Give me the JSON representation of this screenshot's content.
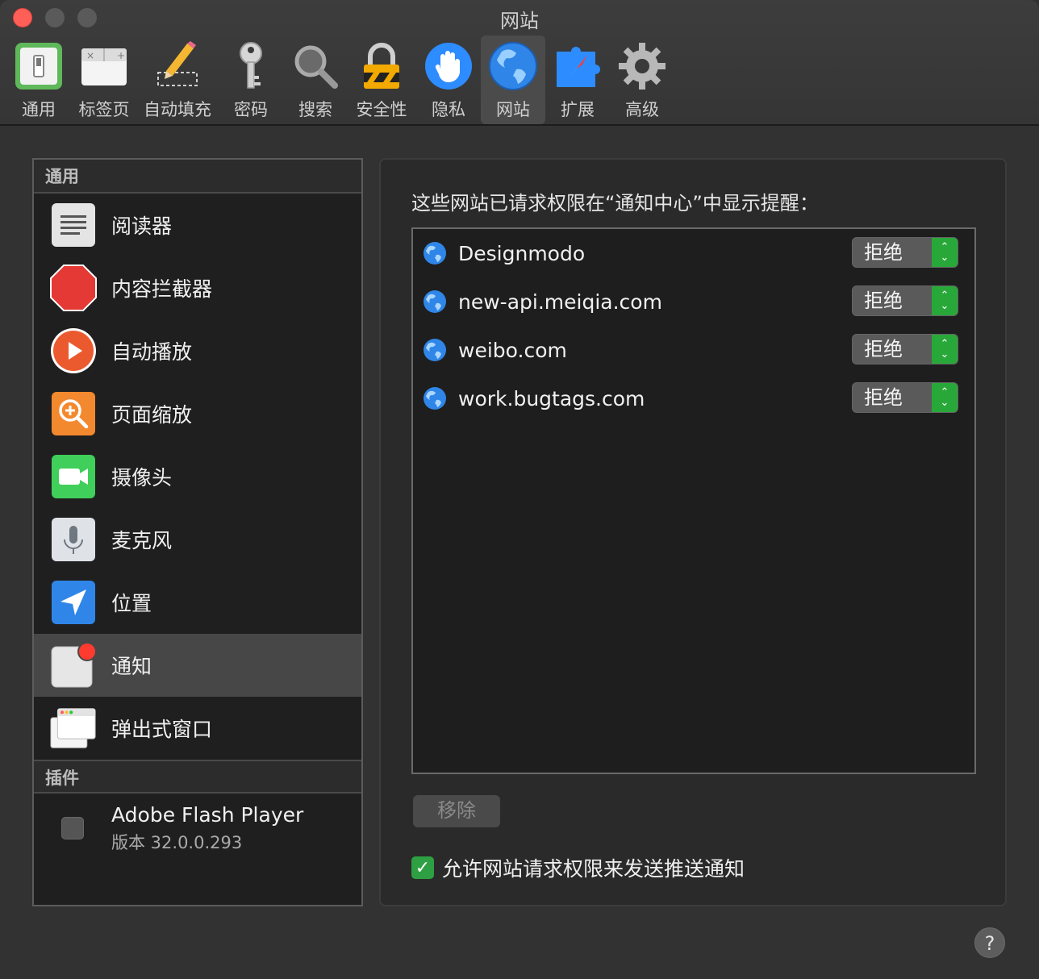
{
  "window": {
    "title": "网站"
  },
  "toolbar": {
    "items": [
      {
        "label": "通用",
        "icon": "general-switch-icon"
      },
      {
        "label": "标签页",
        "icon": "tabs-icon"
      },
      {
        "label": "自动填充",
        "icon": "pencil-icon"
      },
      {
        "label": "密码",
        "icon": "key-icon"
      },
      {
        "label": "搜索",
        "icon": "magnifier-icon"
      },
      {
        "label": "安全性",
        "icon": "lock-icon"
      },
      {
        "label": "隐私",
        "icon": "hand-icon"
      },
      {
        "label": "网站",
        "icon": "globe-icon",
        "selected": true
      },
      {
        "label": "扩展",
        "icon": "puzzle-icon"
      },
      {
        "label": "高级",
        "icon": "gear-icon"
      }
    ]
  },
  "sidebar": {
    "general_header": "通用",
    "items": [
      {
        "label": "阅读器",
        "icon": "reader-icon"
      },
      {
        "label": "内容拦截器",
        "icon": "stop-sign-icon"
      },
      {
        "label": "自动播放",
        "icon": "play-icon"
      },
      {
        "label": "页面缩放",
        "icon": "zoom-icon"
      },
      {
        "label": "摄像头",
        "icon": "camera-icon"
      },
      {
        "label": "麦克风",
        "icon": "microphone-icon"
      },
      {
        "label": "位置",
        "icon": "location-icon"
      },
      {
        "label": "通知",
        "icon": "notification-icon",
        "selected": true
      },
      {
        "label": "弹出式窗口",
        "icon": "popup-window-icon"
      }
    ],
    "plugins_header": "插件",
    "plugin": {
      "name": "Adobe Flash Player",
      "version": "版本 32.0.0.293"
    }
  },
  "panel": {
    "heading": "这些网站已请求权限在“通知中心”中显示提醒：",
    "sites": [
      {
        "name": "Designmodo",
        "value": "拒绝"
      },
      {
        "name": "new-api.meiqia.com",
        "value": "拒绝"
      },
      {
        "name": "weibo.com",
        "value": "拒绝"
      },
      {
        "name": "work.bugtags.com",
        "value": "拒绝"
      }
    ],
    "remove_label": "移除",
    "allow_label": "允许网站请求权限来发送推送通知",
    "allow_checked": true
  },
  "help_label": "?",
  "colors": {
    "accent_green": "#29a83a",
    "close_red": "#ff5f57",
    "selection": "#474747"
  }
}
